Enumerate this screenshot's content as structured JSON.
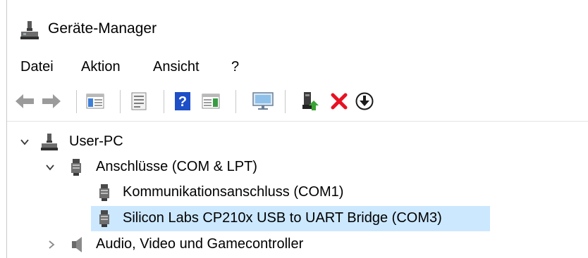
{
  "window": {
    "title": "Geräte-Manager"
  },
  "menubar": {
    "items": [
      "Datei",
      "Aktion",
      "Ansicht",
      "?"
    ]
  },
  "toolbar": {
    "buttons": [
      "back-arrow-icon",
      "forward-arrow-icon",
      "show-hide-console-tree-icon",
      "properties-icon",
      "help-icon",
      "action-pane-icon",
      "monitor-icon",
      "update-driver-icon",
      "uninstall-device-icon",
      "disable-device-icon"
    ]
  },
  "tree": {
    "root": {
      "label": "User-PC",
      "expanded": true
    },
    "category_ports": {
      "label": "Anschlüsse (COM & LPT)",
      "expanded": true
    },
    "device_com1": {
      "label": "Kommunikationsanschluss (COM1)"
    },
    "device_com3": {
      "label": "Silicon Labs CP210x USB to UART Bridge (COM3)",
      "selected": true
    },
    "category_audio": {
      "label": "Audio, Video und Gamecontroller",
      "expanded": false
    }
  },
  "colors": {
    "selection": "#cce8ff",
    "help_blue": "#1e4fc7",
    "delete_red": "#e81123",
    "update_green": "#3aa335"
  }
}
